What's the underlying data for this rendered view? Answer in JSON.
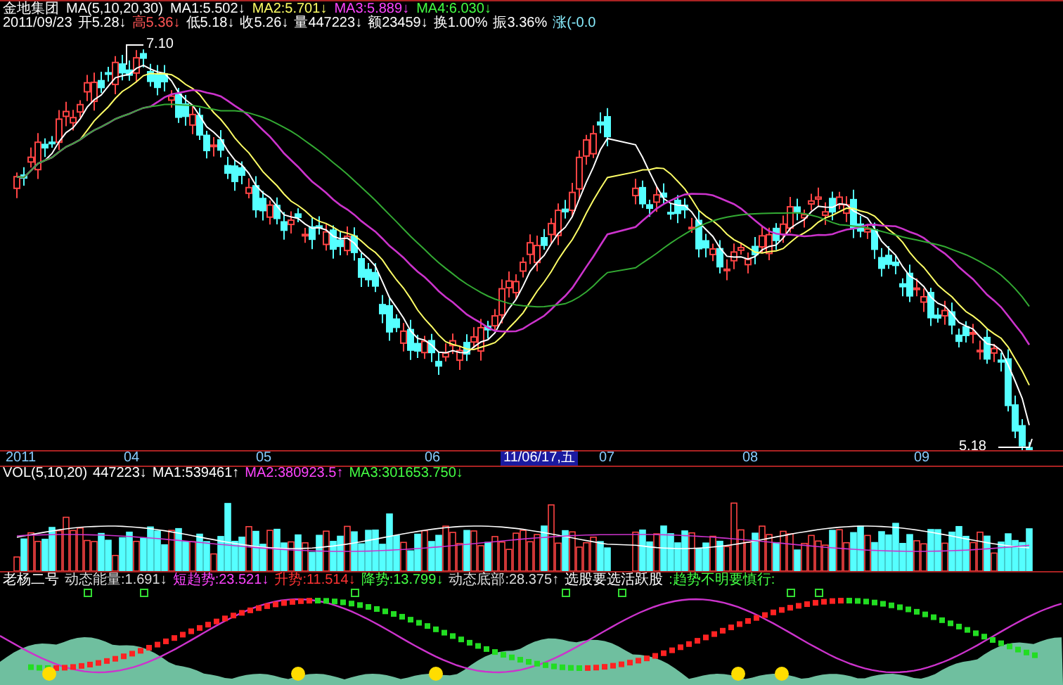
{
  "title_row": {
    "stock": "金地集团",
    "ma_label": "MA(5,10,20,30)",
    "items": [
      {
        "text": "MA1:5.502",
        "arrow": "↓",
        "color": "#ffffff"
      },
      {
        "text": "MA2:5.701",
        "arrow": "↓",
        "color": "#ffff66"
      },
      {
        "text": "MA3:5.889",
        "arrow": "↓",
        "color": "#ff44ff"
      },
      {
        "text": "MA4:6.030",
        "arrow": "↓",
        "color": "#44ff44"
      }
    ]
  },
  "quote_row": {
    "date": "2011/09/23",
    "items": [
      {
        "text": "开5.28",
        "arrow": "↓",
        "color": "#ffffff"
      },
      {
        "text": "高5.36",
        "arrow": "↓",
        "color": "#ff5555"
      },
      {
        "text": "低5.18",
        "arrow": "↓",
        "color": "#ffffff"
      },
      {
        "text": "收5.26",
        "arrow": "↓",
        "color": "#ffffff"
      },
      {
        "text": "量447223",
        "arrow": "↓",
        "color": "#ffffff"
      },
      {
        "text": "额23459",
        "arrow": "↓",
        "color": "#ffffff"
      },
      {
        "text": "换1.00%",
        "color": "#ffffff"
      },
      {
        "text": "振3.36%",
        "color": "#ffffff"
      },
      {
        "text": "涨(-0.0",
        "color": "#88eeff"
      }
    ]
  },
  "price_labels": {
    "high": "7.10",
    "low": "5.18"
  },
  "x_axis": [
    {
      "label": "2011",
      "selected": false
    },
    {
      "label": "04",
      "selected": false
    },
    {
      "label": "05",
      "selected": false
    },
    {
      "label": "06",
      "selected": false
    },
    {
      "label": "11/06/17,五",
      "selected": true
    },
    {
      "label": "07",
      "selected": false
    },
    {
      "label": "08",
      "selected": false
    },
    {
      "label": "09",
      "selected": false
    }
  ],
  "volume_row": {
    "label": "VOL(5,10,20)",
    "items": [
      {
        "text": "447223",
        "arrow": "↓",
        "color": "#ffffff"
      },
      {
        "text": "MA1:539461",
        "arrow": "↑",
        "color": "#ffffff"
      },
      {
        "text": "MA2:380923.5",
        "arrow": "↑",
        "color": "#ff44ff"
      },
      {
        "text": "MA3:301653.750",
        "arrow": "↓",
        "color": "#44ff44"
      }
    ]
  },
  "indicator_row": {
    "name": "老杨二号",
    "items": [
      {
        "text": "动态能量:1.691",
        "arrow": "↓",
        "color": "#dddddd"
      },
      {
        "text": "短趋势:23.521",
        "arrow": "↓",
        "color": "#ff44ff"
      },
      {
        "text": "升势:11.514",
        "arrow": "↓",
        "color": "#ff3333"
      },
      {
        "text": "降势:13.799",
        "arrow": "↓",
        "color": "#44ff44"
      },
      {
        "text": "动态底部:28.375",
        "arrow": "↑",
        "color": "#dddddd"
      },
      {
        "text": "选股要选活跃股",
        "color": "#ffffff"
      },
      {
        "text": ":趋势不明要慎行:",
        "color": "#44ff44"
      }
    ]
  }
}
